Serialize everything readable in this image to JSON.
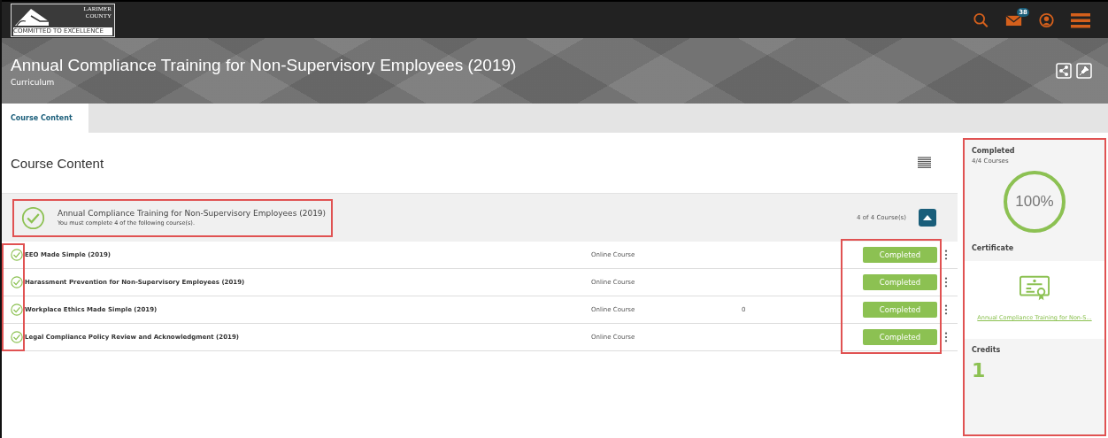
{
  "logo": {
    "line_1": "LARIMER",
    "line_2": "COUNTY",
    "tagline": "COMMITTED TO EXCELLENCE"
  },
  "top_bar": {
    "mail_badge": "38"
  },
  "banner": {
    "title": "Annual Compliance Training for Non-Supervisory Employees (2019)",
    "subtitle": "Curriculum"
  },
  "tabs": [
    {
      "label": "Course Content",
      "selected": true
    }
  ],
  "content": {
    "heading": "Course Content",
    "group": {
      "title": "Annual Compliance Training for Non-Supervisory Employees (2019)",
      "note": "You must complete 4 of the following course(s).",
      "count": "4 of 4 Course(s)",
      "completed": true,
      "expanded": true
    },
    "courses": [
      {
        "title": "EEO Made Simple (2019)",
        "type": "Online Course",
        "status": "Completed",
        "completed": true
      },
      {
        "title": "Harassment Prevention for Non-Supervisory Employees (2019)",
        "type": "Online Course",
        "status": "Completed",
        "completed": true
      },
      {
        "title": "Workplace Ethics Made Simple (2019)",
        "type": "Online Course",
        "column_3": "0",
        "status": "Completed",
        "completed": true
      },
      {
        "title": "Legal Compliance Policy Review and Acknowledgment (2019)",
        "type": "Online Course",
        "status": "Completed",
        "completed": true
      }
    ]
  },
  "sidebar": {
    "completed_label": "Completed",
    "completed_count": "4/4 Courses",
    "percent": "100%",
    "certificate_label": "Certificate",
    "certificate_link": "Annual Compliance Training for Non-S...",
    "credits_label": "Credits",
    "credits": "1"
  }
}
